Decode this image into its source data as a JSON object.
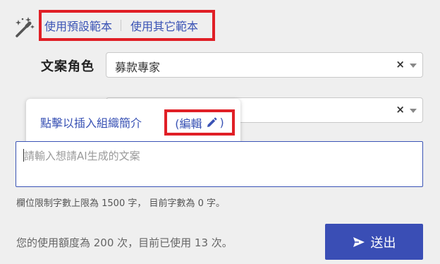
{
  "templates": {
    "use_preset": "使用預設範本",
    "use_other": "使用其它範本"
  },
  "copy_role": {
    "label": "文案角色",
    "value": "募款專家",
    "clear": "×"
  },
  "second_select": {
    "clear": "×"
  },
  "org_popover": {
    "insert_text": "點擊以插入組織簡介",
    "edit_label_open": "(編輯",
    "edit_label_close": ")"
  },
  "prompt": {
    "placeholder": "請輸入想請AI生成的文案"
  },
  "limit_text": "欄位限制字數上限為 1500 字， 目前字數為 0 字。",
  "usage_text": "您的使用額度為 200 次，目前已使用 13 次。",
  "submit_label": "送出",
  "colors": {
    "accent": "#3a4eb5",
    "highlight_border": "#e01f26"
  }
}
